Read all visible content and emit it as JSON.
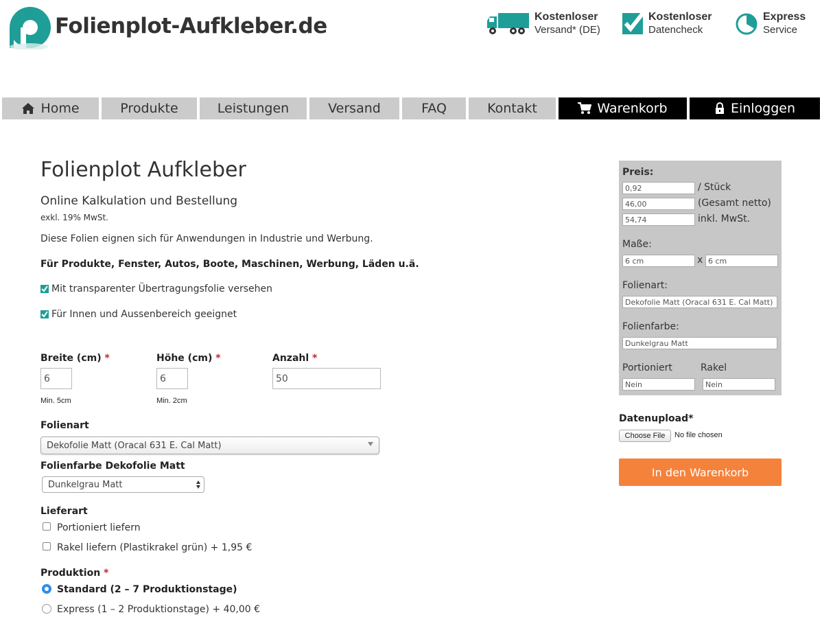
{
  "brand": {
    "name": "Folienplot-Aufkleber.de",
    "teal": "#1e9e97"
  },
  "usps": [
    {
      "bold": "Kostenloser",
      "normal": "Versand* (DE)",
      "icon": "truck-icon"
    },
    {
      "bold": "Kostenloser",
      "normal": "Datencheck",
      "icon": "checkmark-icon"
    },
    {
      "bold": "Express",
      "normal": "Service",
      "icon": "clock-icon"
    }
  ],
  "nav": {
    "home": "Home",
    "produkte": "Produkte",
    "leistungen": "Leistungen",
    "versand": "Versand",
    "faq": "FAQ",
    "kontakt": "Kontakt",
    "warenkorb": "Warenkorb",
    "einloggen": "Einloggen"
  },
  "main": {
    "title": "Folienplot Aufkleber",
    "subtitle": "Online Kalkulation und Bestellung",
    "tax_note": "exkl. 19% MwSt.",
    "description": "Diese Folien eignen sich für Anwendungen in Industrie und Werbung.",
    "description_bold": "Für Produkte, Fenster, Autos, Boote, Maschinen, Werbung, Läden u.ä.",
    "features": [
      "Mit transparenter Übertragungsfolie versehen",
      "Für Innen und Aussenbereich geeignet"
    ]
  },
  "form": {
    "breite": {
      "label": "Breite (cm)",
      "value": "6",
      "hint": "Min. 5cm"
    },
    "hoehe": {
      "label": "Höhe (cm)",
      "value": "6",
      "hint": "Min. 2cm"
    },
    "anzahl": {
      "label": "Anzahl",
      "value": "50"
    },
    "required_mark": "*",
    "folienart": {
      "label": "Folienart",
      "selected": "Dekofolie Matt (Oracal 631 E. Cal Matt)"
    },
    "folienfarbe": {
      "label": "Folienfarbe Dekofolie Matt",
      "selected": "Dunkelgrau Matt"
    },
    "lieferart": {
      "label": "Lieferart",
      "options": [
        "Portioniert liefern",
        "Rakel liefern (Plastikrakel grün) + 1,95 €"
      ]
    },
    "produktion": {
      "label": "Produktion",
      "options": [
        "Standard (2 – 7 Produktionstage)",
        "Express (1 – 2 Produktionstage) + 40,00 €"
      ],
      "selected_index": 0
    }
  },
  "summary": {
    "preis_label": "Preis:",
    "stueck_value": "0,92",
    "stueck_suffix": "/ Stück",
    "gesamt_value": "46,00",
    "gesamt_suffix": "(Gesamt netto)",
    "inkl_value": "54,74",
    "inkl_suffix": "inkl. MwSt.",
    "masse_label": "Maße:",
    "masse_w": "6 cm",
    "masse_x": "x",
    "masse_h": "6 cm",
    "folienart_label": "Folienart:",
    "folienart_value": "Dekofolie Matt (Oracal 631 E. Cal Matt)",
    "folienfarbe_label": "Folienfarbe:",
    "folienfarbe_value": "Dunkelgrau Matt",
    "portioniert_label": "Portioniert",
    "portioniert_value": "Nein",
    "rakel_label": "Rakel",
    "rakel_value": "Nein"
  },
  "upload": {
    "label": "Datenupload*",
    "button": "Choose File",
    "status": "No file chosen"
  },
  "cart_button": "In den Warenkorb",
  "colors": {
    "nav_gray": "#cbcbcb",
    "nav_dark": "#000000",
    "sidebar_gray": "#c7c7c7",
    "cta_orange": "#f5823b",
    "required_red": "#c0262d",
    "radio_blue": "#2f8ded"
  }
}
